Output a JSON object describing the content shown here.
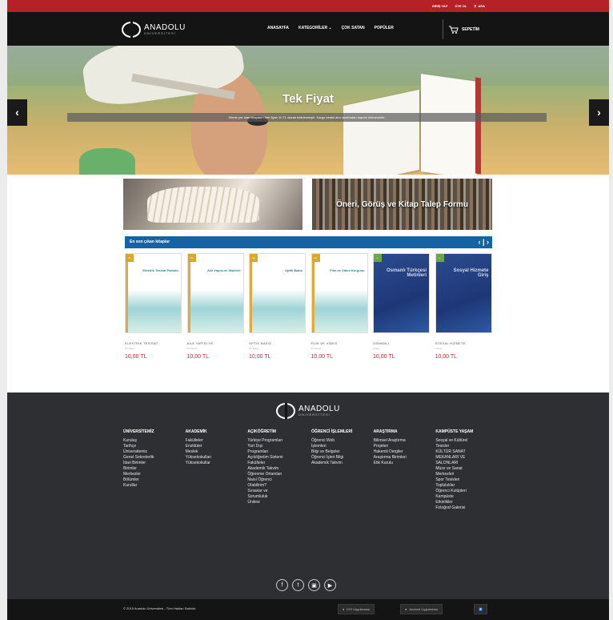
{
  "topbar": {
    "login": "GİRİŞ YAP",
    "register": "ÜYE OL",
    "search": "ARA"
  },
  "brand": {
    "name": "ANADOLU",
    "sub": "ÜNİVERSİTESİ"
  },
  "nav": {
    "items": [
      "ANASAYFA",
      "KATEGORİLER ⌄",
      "ÇOK SATAN",
      "POPÜLER"
    ],
    "cart": "SEPETİM"
  },
  "hero": {
    "title": "Tek Fiyat",
    "strip": "Sitede yer alan kitapların tüm fiyatı 10 TL olarak belirlenmiştir. Kargo bedeli alıcı tarafından kapıda ödenecektir."
  },
  "banners": {
    "right": "Öneri, Görüş ve Kitap Talep Formu"
  },
  "new_section": {
    "title": "En son çıkan kitaplar",
    "controls": "‹ | ›"
  },
  "products": [
    {
      "cover_title": "Elektrik Tesisat Planları",
      "name": "ELEKTRİK TESİSAT",
      "sub": "Ön lisans",
      "price": "10,00 TL",
      "dark": false,
      "badge": "OL"
    },
    {
      "cover_title": "Aile Yapısı ve İlişkileri",
      "name": "AİLE YAPISI VE",
      "sub": "Ön lisans",
      "price": "10,00 TL",
      "dark": false,
      "badge": "OL"
    },
    {
      "cover_title": "Optik Bakış",
      "name": "OPTİK BAKIŞ",
      "sub": "Ön lisans",
      "price": "10,00 TL",
      "dark": false,
      "badge": "OL"
    },
    {
      "cover_title": "Film ve Video Kurgusu",
      "name": "FİLM VE VİDEO",
      "sub": "Ön lisans",
      "price": "10,00 TL",
      "dark": false,
      "badge": "OL"
    },
    {
      "cover_title": "Osmanlı Türkçesi Metinleri",
      "name": "OSMANLI",
      "sub": "Lisans",
      "price": "10,00 TL",
      "dark": true,
      "badge": "L"
    },
    {
      "cover_title": "Sosyal Hizmete Giriş",
      "name": "SOSYAL HİZMETE",
      "sub": "Lisans",
      "price": "10,00 TL",
      "dark": true,
      "badge": "L"
    }
  ],
  "footer_columns": [
    {
      "title": "ÜNİVERSİTEMİZ",
      "items": [
        "Kuruluş",
        "Tarihçe",
        "Üniversitemiz",
        "Genel Sekreterlik",
        "İdari Birimler",
        "Birimler",
        "Merkezler",
        "Bölümler",
        "Kurullar"
      ]
    },
    {
      "title": "AKADEMİK",
      "items": [
        "Fakülteler",
        "Enstitüler",
        "Meslek",
        "Yüksekokulları",
        "Yüksekokullar"
      ]
    },
    {
      "title": "AÇIKÖĞRETİM",
      "items": [
        "Türkiye Programları",
        "Yurt Dışı",
        "Programları",
        "Açıköğretim Sistemi",
        "Fakülteler",
        "Akademik Takvim",
        "Öğrenme Ortamları",
        "Nasıl Öğrenci",
        "Olabilirim?",
        "Sınavlar ve",
        "Sorumluluk",
        "Ünitesi"
      ]
    },
    {
      "title": "ÖĞRENCİ İŞLEMLERİ",
      "items": [
        "Öğrenci Web",
        "İşlemleri",
        "Bilgi ve Belgeler",
        "Öğrenci İşleri Bilgi",
        "Akademik Takvim"
      ]
    },
    {
      "title": "ARAŞTIRMA",
      "items": [
        "Bilimsel Araştırma",
        "Projeleri",
        "Hakemli Dergiler",
        "Araştırma Birimleri",
        "Etik Kurulu"
      ]
    },
    {
      "title": "KAMPÜSTE YAŞAM",
      "items": [
        "Sosyal ve Kültürel",
        "Tesisler",
        "KÜLTÜR SANAT",
        "MEKANLARI VE",
        "SALONLARI",
        "Müze ve Sanat",
        "Merkezleri",
        "Spor Tesisleri",
        "Topluluklar",
        "Öğrenci Kulüpleri",
        "Kampüste",
        "Etkinlikler",
        "Fotoğraf Galerisi"
      ]
    }
  ],
  "footer": {
    "copyright": "© 2015 Anadolu Üniversitesi - Tüm Hakları Saklıdır.",
    "ios": "iOS Uygulaması",
    "android": "Android Uygulaması",
    "social": [
      "f",
      "t",
      "▣",
      "▶"
    ]
  }
}
